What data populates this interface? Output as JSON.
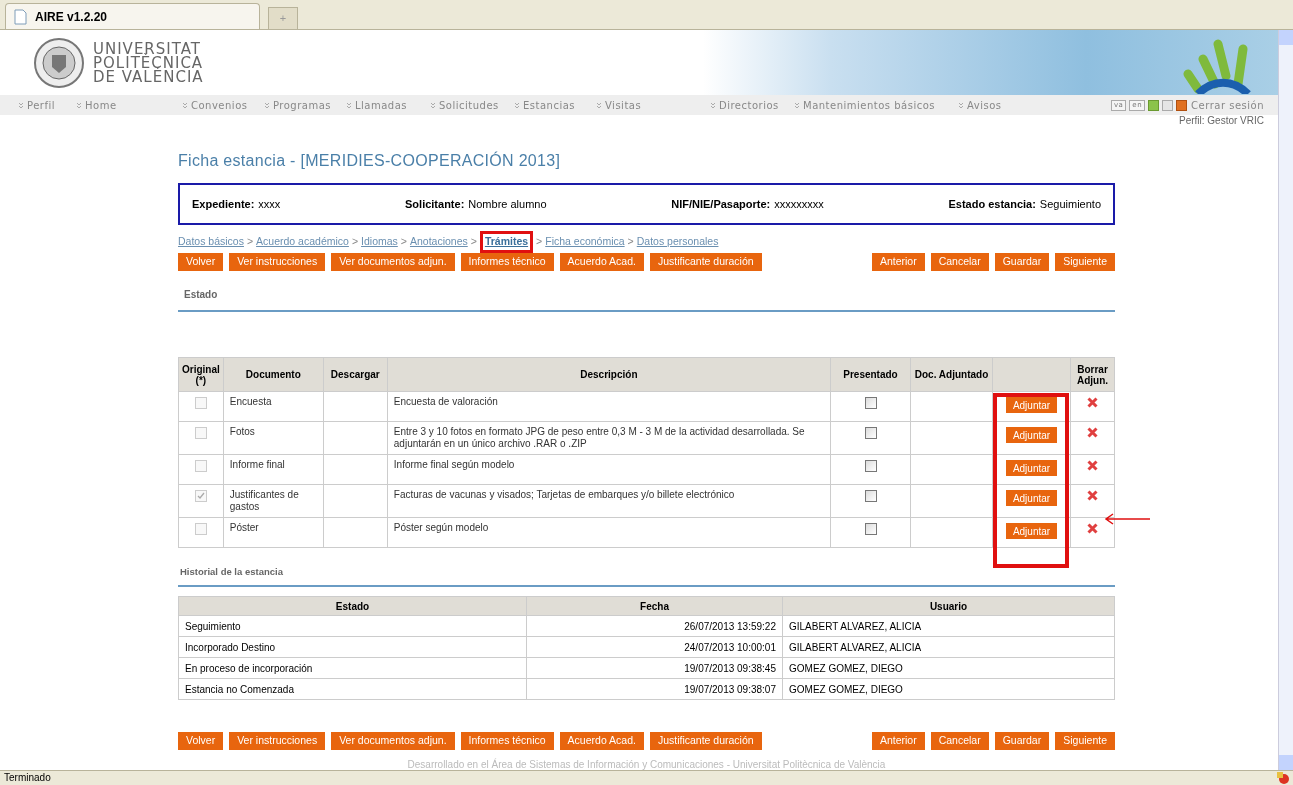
{
  "browser": {
    "tab_title": "AIRE v1.2.20",
    "new_tab": "+",
    "status": "Terminado"
  },
  "header": {
    "logo_lines": [
      "UNIVERSITAT",
      "POLITÈCNICA",
      "DE VALÈNCIA"
    ]
  },
  "nav": {
    "items": [
      "Perfil",
      "Home",
      "Convenios",
      "Programas",
      "Llamadas",
      "Solicitudes",
      "Estancias",
      "Visitas",
      "Directorios",
      "Mantenimientos básicos",
      "Avisos"
    ],
    "languages": [
      "va",
      "en"
    ],
    "logout": "Cerrar sesión",
    "profile": "Perfil: Gestor VRIC"
  },
  "page_title": "Ficha estancia - [MERIDIES-COOPERACIÓN 2013]",
  "summary": [
    {
      "label": "Expediente:",
      "value": "xxxx"
    },
    {
      "label": "Solicitante:",
      "value": "Nombre alumno"
    },
    {
      "label": "NIF/NIE/Pasaporte:",
      "value": "xxxxxxxxx"
    },
    {
      "label": "Estado estancia:",
      "value": "Seguimiento"
    }
  ],
  "breadcrumb": [
    {
      "label": "Datos básicos",
      "selected": false
    },
    {
      "label": "Acuerdo académico",
      "selected": false
    },
    {
      "label": "Idiomas",
      "selected": false
    },
    {
      "label": "Anotaciones",
      "selected": false
    },
    {
      "label": "Trámites",
      "selected": true
    },
    {
      "label": "Ficha económica",
      "selected": false
    },
    {
      "label": "Datos personales",
      "selected": false
    }
  ],
  "separator": ">",
  "top_bar": {
    "buttons_left": [
      "Volver",
      "Ver instrucciones",
      "Ver documentos adjun.",
      "Informes técnico",
      "Acuerdo Acad.",
      "Justificante duración"
    ],
    "buttons_right": [
      "Anterior",
      "Cancelar",
      "Guardar",
      "Siguiente"
    ]
  },
  "estado_heading": "Estado",
  "documents": {
    "columns": [
      "Original (*)",
      "Documento",
      "Descargar",
      "Descripción",
      "Presentado",
      "Doc. Adjuntado",
      "Borrar Adjun."
    ],
    "rows": [
      {
        "original": false,
        "document": "Encuesta",
        "description": "Encuesta de valoración",
        "presented": false,
        "attach": "Adjuntar"
      },
      {
        "original": false,
        "document": "Fotos",
        "description": "Entre 3 y 10 fotos en formato JPG de peso entre 0,3 M - 3 M de la actividad desarrollada. Se adjuntarán en un único archivo .RAR o .ZIP",
        "presented": false,
        "attach": "Adjuntar"
      },
      {
        "original": false,
        "document": "Informe final",
        "description": "Informe final según modelo",
        "presented": false,
        "attach": "Adjuntar"
      },
      {
        "original": true,
        "document": "Justificantes de gastos",
        "description": "Facturas de vacunas y visados; Tarjetas de embarques y/o billete electrónico",
        "presented": false,
        "attach": "Adjuntar"
      },
      {
        "original": false,
        "document": "Póster",
        "description": "Póster según modelo",
        "presented": false,
        "attach": "Adjuntar"
      }
    ]
  },
  "history": {
    "heading": "Historial de la estancia",
    "columns": [
      "Estado",
      "Fecha",
      "Usuario"
    ],
    "rows": [
      [
        "Seguimiento",
        "26/07/2013 13:59:22",
        "GILABERT ALVAREZ, ALICIA"
      ],
      [
        "Incorporado Destino",
        "24/07/2013 10:00:01",
        "GILABERT ALVAREZ, ALICIA"
      ],
      [
        "En proceso de incorporación",
        "19/07/2013 09:38:45",
        "GOMEZ GOMEZ, DIEGO"
      ],
      [
        "Estancia no Comenzada",
        "19/07/2013 09:38:07",
        "GOMEZ GOMEZ, DIEGO"
      ]
    ]
  },
  "bottom_bar": {
    "buttons_left": [
      "Volver",
      "Ver instrucciones",
      "Ver documentos adjun.",
      "Informes técnico",
      "Acuerdo Acad.",
      "Justificante duración"
    ],
    "buttons_right": [
      "Anterior",
      "Cancelar",
      "Guardar",
      "Siguiente"
    ]
  },
  "footer": "Desarrollado en el Área de Sistemas de Información y Comunicaciones - Universitat Politècnica de València"
}
